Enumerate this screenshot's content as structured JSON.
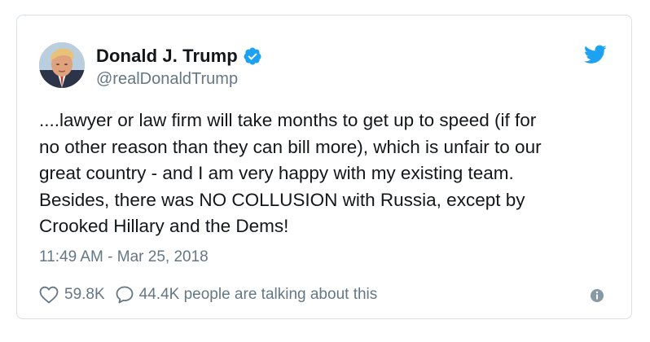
{
  "tweet": {
    "display_name": "Donald J. Trump",
    "handle": "@realDonaldTrump",
    "text": "....lawyer or law firm will take months to get up to speed (if for\nno other reason than they can bill more), which is unfair to our\ngreat country - and I am very happy with my existing team.\nBesides, there was NO COLLUSION with Russia, except by\nCrooked Hillary and the Dems!",
    "timestamp": "11:49 AM - Mar 25, 2018",
    "like_count": "59.8K",
    "talking_text": "44.4K people are talking about this"
  },
  "icons": {
    "verified": "verified-badge-icon",
    "brand": "twitter-bird-icon",
    "like": "heart-icon",
    "reply": "speech-bubble-icon",
    "info": "info-icon"
  },
  "colors": {
    "brand_blue": "#1da1f2",
    "text_primary": "#14171a",
    "text_secondary": "#657786",
    "border": "#d9dfe4"
  }
}
